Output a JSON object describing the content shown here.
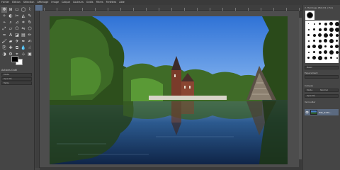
{
  "menubar": {
    "items": [
      "Fichier",
      "Édition",
      "Sélection",
      "Affichage",
      "Image",
      "Calque",
      "Couleurs",
      "Outils",
      "Filtres",
      "Fenêtres",
      "Aide"
    ]
  },
  "toolbox": {
    "tools": [
      {
        "name": "move-tool-icon",
        "glyph": "✥"
      },
      {
        "name": "align-tool-icon",
        "glyph": "⊞"
      },
      {
        "name": "rect-select-icon",
        "glyph": "▭"
      },
      {
        "name": "ellipse-select-icon",
        "glyph": "◯"
      },
      {
        "name": "free-select-icon",
        "glyph": "⌇"
      },
      {
        "name": "fuzzy-select-icon",
        "glyph": "✧"
      },
      {
        "name": "color-select-icon",
        "glyph": "◐"
      },
      {
        "name": "scissors-icon",
        "glyph": "✂"
      },
      {
        "name": "foreground-select-icon",
        "glyph": "◭"
      },
      {
        "name": "paths-icon",
        "glyph": "✎"
      },
      {
        "name": "color-picker-icon",
        "glyph": "⌁"
      },
      {
        "name": "zoom-icon",
        "glyph": "⌕"
      },
      {
        "name": "measure-icon",
        "glyph": "⊿"
      },
      {
        "name": "crop-icon",
        "glyph": "⌗"
      },
      {
        "name": "rotate-icon",
        "glyph": "↻"
      },
      {
        "name": "scale-icon",
        "glyph": "⤢"
      },
      {
        "name": "shear-icon",
        "glyph": "▱"
      },
      {
        "name": "perspective-icon",
        "glyph": "⬠"
      },
      {
        "name": "flip-icon",
        "glyph": "⇋"
      },
      {
        "name": "cage-icon",
        "glyph": "⬡"
      },
      {
        "name": "warp-icon",
        "glyph": "≈"
      },
      {
        "name": "text-icon",
        "glyph": "A"
      },
      {
        "name": "bucket-fill-icon",
        "glyph": "◪"
      },
      {
        "name": "gradient-icon",
        "glyph": "▤"
      },
      {
        "name": "pencil-icon",
        "glyph": "✏"
      },
      {
        "name": "paintbrush-icon",
        "glyph": "🖌"
      },
      {
        "name": "eraser-icon",
        "glyph": "▰"
      },
      {
        "name": "airbrush-icon",
        "glyph": "✈"
      },
      {
        "name": "ink-icon",
        "glyph": "✒"
      },
      {
        "name": "mypaint-icon",
        "glyph": "✍"
      },
      {
        "name": "clone-icon",
        "glyph": "⎘"
      },
      {
        "name": "heal-icon",
        "glyph": "✚"
      },
      {
        "name": "perspective-clone-icon",
        "glyph": "⧉"
      },
      {
        "name": "blur-icon",
        "glyph": "💧"
      },
      {
        "name": "smudge-icon",
        "glyph": "☝"
      },
      {
        "name": "dodge-burn-icon",
        "glyph": "◑"
      },
      {
        "name": "fg-select-extra-icon",
        "glyph": "⚙"
      },
      {
        "name": "unified-transform-icon",
        "glyph": "⌖"
      },
      {
        "name": "handle-transform-icon",
        "glyph": "⊹"
      },
      {
        "name": "paint-select-icon",
        "glyph": "▣"
      }
    ],
    "options_title": "Actions Outil",
    "options_rows": [
      "Mode",
      "Opacité",
      "Taille"
    ]
  },
  "dock": {
    "brushes_title": "2. Hardness 050 (51 × 51)",
    "brush_sizes": [
      1,
      2,
      3,
      4,
      5,
      6,
      2,
      3,
      4,
      5,
      6,
      6,
      3,
      4,
      5,
      6,
      5,
      4,
      2,
      3,
      4,
      5,
      6,
      3,
      4,
      5,
      6,
      3,
      4,
      5,
      2,
      3,
      4,
      5,
      6,
      4,
      3,
      5,
      6,
      4,
      3,
      2
    ],
    "basic_label": "Basic",
    "spacing_label": "Espacement",
    "layers_title": "Calques",
    "mode_label": "Mode",
    "mode_value": "Normal",
    "opacity_label": "Opacité",
    "lock_label": "Verrouiller",
    "layer_name": "IMG_3439..."
  },
  "colors": {
    "sky_top": "#2f72d6",
    "sky_bottom": "#7fb2f0",
    "water": "#1c3a6a"
  }
}
